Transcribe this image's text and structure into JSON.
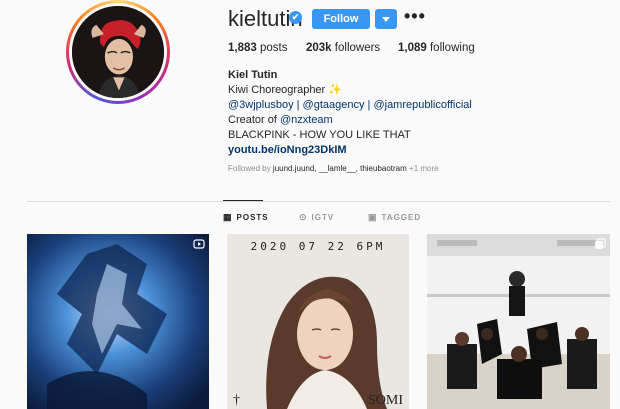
{
  "profile": {
    "username": "kieltutin",
    "verified_mark": "✔",
    "follow_label": "Follow",
    "more_label": "•••"
  },
  "stats": {
    "posts_count": "1,883",
    "posts_label": "posts",
    "followers_count": "203k",
    "followers_label": "followers",
    "following_count": "1,089",
    "following_label": "following"
  },
  "bio": {
    "name": "Kiel Tutin",
    "line1": "Kiwi Choreographer ✨",
    "line2": "@3wjplusboy | @gtaagency | @jamrepublicofficial",
    "line3_prefix": "Creator of ",
    "line3_link": "@nzxteam",
    "line4": "BLACKPINK - HOW YOU LIKE THAT",
    "url": "youtu.be/ioNng23DkIM"
  },
  "followed_by": {
    "prefix": "Followed by ",
    "names": "juund.juund, __lamle__, thieubaotram",
    "suffix": " +1 more"
  },
  "tabs": [
    {
      "label": "POSTS",
      "icon": "grid-icon"
    },
    {
      "label": "IGTV",
      "icon": "igtv-icon"
    },
    {
      "label": "TAGGED",
      "icon": "tag-icon"
    }
  ],
  "posts": [
    {
      "type": "video-icon"
    },
    {
      "date_text": "2020 07 22 6PM",
      "mark_left": "†",
      "mark_right": "SOMI"
    },
    {
      "type": "carousel-icon"
    }
  ],
  "colors": {
    "accent": "#3897f0",
    "link": "#003569"
  }
}
